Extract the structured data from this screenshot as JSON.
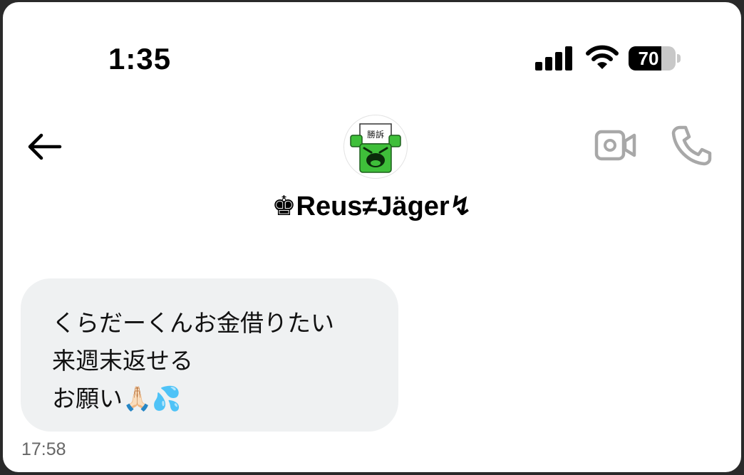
{
  "status_bar": {
    "time": "1:35",
    "battery_percent": 70,
    "battery_label": "70",
    "signal_bars": 4
  },
  "header": {
    "back_icon": "arrow-left-icon",
    "video_icon": "video-camera-icon",
    "call_icon": "phone-icon",
    "avatar_sign_text": "勝訴",
    "contact_name": "♚Reus≠Jäger↯"
  },
  "messages": [
    {
      "direction": "incoming",
      "lines": [
        "くらだーくんお金借りたい",
        "来週末返せる",
        "お願い🙏🏻💦"
      ],
      "time": "17:58"
    }
  ],
  "colors": {
    "bubble_incoming": "#eff1f2",
    "icon_gray": "#a8a8a8",
    "avatar_green": "#34c759"
  }
}
